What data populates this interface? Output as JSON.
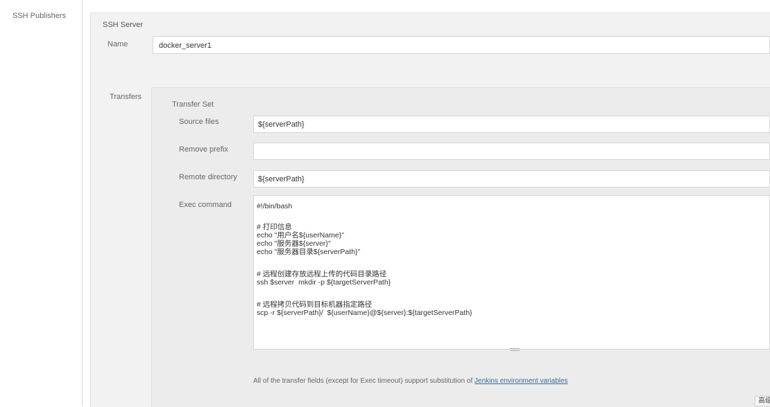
{
  "section": {
    "label": "SSH Publishers"
  },
  "server": {
    "title": "SSH Server",
    "name_label": "Name",
    "name_value": "docker_server1",
    "transfers_label": "Transfers"
  },
  "transfer_set": {
    "title": "Transfer Set",
    "source_files_label": "Source files",
    "source_files_value": "${serverPath}",
    "remove_prefix_label": "Remove prefix",
    "remove_prefix_value": "",
    "remote_directory_label": "Remote directory",
    "remote_directory_value": "${serverPath}",
    "exec_command_label": "Exec command",
    "exec_command_lines": [
      "#!/bin/bash",
      "",
      "# 打印信息",
      "echo \"用户名${userName}\"",
      "echo \"服务器${server}\"",
      "echo \"服务器目录${serverPath}\"",
      "",
      "# 远程创建存放远程上传的代码目录路径",
      "ssh $server  mkdir -p ${targetServerPath}",
      "",
      "# 远程拷贝代码到目标机器指定路径",
      "scp -r ${serverPath}/  ${userName}@${server}:${targetServerPath}"
    ],
    "help_text": "All of the transfer fields (except for Exec timeout) support substitution of ",
    "help_link": "Jenkins environment variables",
    "advanced_button": "高级..."
  }
}
